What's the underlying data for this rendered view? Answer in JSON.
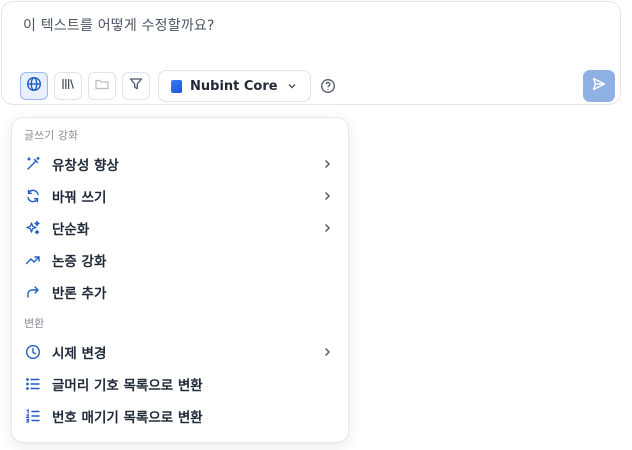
{
  "composer": {
    "prompt_text": "이 텍스트를 어떻게 수정할까요?",
    "model_name": "Nubint Core"
  },
  "toolbar": {
    "buttons": [
      {
        "icon": "globe-icon",
        "active": true
      },
      {
        "icon": "library-icon",
        "active": false
      },
      {
        "icon": "folder-icon",
        "active": false,
        "disabled": true
      },
      {
        "icon": "filter-icon",
        "active": false
      }
    ]
  },
  "menu": {
    "section1_label": "글쓰기 강화",
    "section2_label": "변환",
    "items": [
      {
        "label": "유창성 향상",
        "icon": "magic-wand-icon",
        "submenu": true
      },
      {
        "label": "바꿔 쓰기",
        "icon": "refresh-icon",
        "submenu": true
      },
      {
        "label": "단순화",
        "icon": "sparkles-icon",
        "submenu": true
      },
      {
        "label": "논증 강화",
        "icon": "trending-up-icon",
        "submenu": false
      },
      {
        "label": "반론 추가",
        "icon": "redo-arrow-icon",
        "submenu": false
      },
      {
        "label": "시제 변경",
        "icon": "clock-icon",
        "submenu": true
      },
      {
        "label": "글머리 기호 목록으로 변환",
        "icon": "bullet-list-icon",
        "submenu": false
      },
      {
        "label": "번호 매기기 목록으로 변환",
        "icon": "numbered-list-icon",
        "submenu": false
      }
    ]
  },
  "colors": {
    "accent": "#1f5fbf",
    "send_button": "#8fb0e3",
    "active_tool_bg": "#e8efff"
  }
}
